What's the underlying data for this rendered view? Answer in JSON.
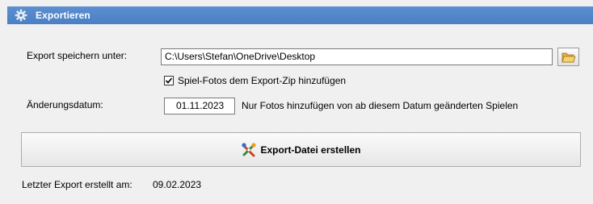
{
  "window": {
    "title": "Exportieren",
    "icon": "gear-icon"
  },
  "export_path": {
    "label": "Export speichern unter:",
    "value": "C:\\Users\\Stefan\\OneDrive\\Desktop",
    "browse_icon": "folder-open-icon"
  },
  "photos_checkbox": {
    "label": "Spiel-Fotos dem Export-Zip hinzufügen",
    "checked": true
  },
  "change_date": {
    "label": "Änderungsdatum:",
    "value": "01.11.2023",
    "hint": "Nur Fotos hinzufügen von ab diesem Datum geänderten Spielen"
  },
  "export_button": {
    "label": "Export-Datei erstellen",
    "icon": "export-tools-icon"
  },
  "last_export": {
    "label": "Letzter Export erstellt am:",
    "value": "09.02.2023"
  },
  "colors": {
    "titlebar": "#4a7fc4",
    "background": "#f0f0f0"
  }
}
